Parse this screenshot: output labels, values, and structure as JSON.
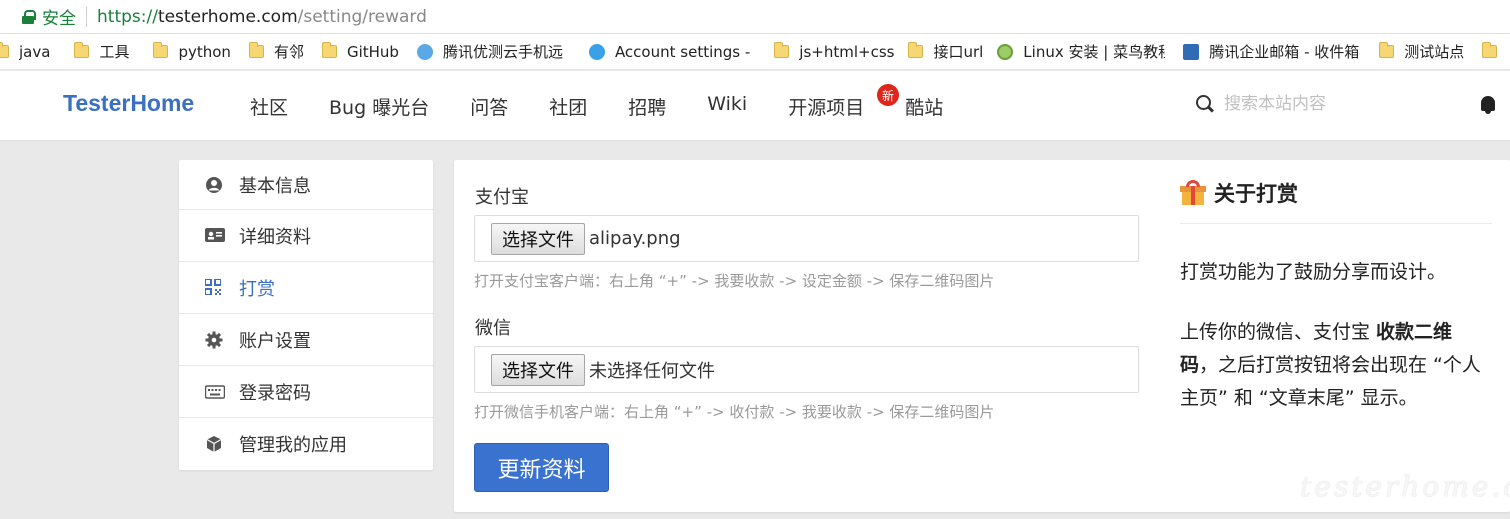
{
  "browser": {
    "secure_label": "安全",
    "url_protocol": "https://",
    "url_host": "testerhome.com",
    "url_path": "/setting/reward"
  },
  "bookmarks": [
    {
      "label": "java",
      "icon": "folder-icon"
    },
    {
      "label": "工具",
      "icon": "folder-icon"
    },
    {
      "label": "python",
      "icon": "folder-icon"
    },
    {
      "label": "有邻",
      "icon": "folder-icon"
    },
    {
      "label": "GitHub",
      "icon": "folder-icon"
    },
    {
      "label": "腾讯优测云手机远程",
      "icon": "cloud-icon"
    },
    {
      "label": "Account settings - ",
      "icon": "account-icon"
    },
    {
      "label": "js+html+css",
      "icon": "folder-icon"
    },
    {
      "label": "接口url",
      "icon": "folder-icon"
    },
    {
      "label": "Linux 安装 | 菜鸟教程",
      "icon": "linux-icon"
    },
    {
      "label": "腾讯企业邮箱 - 收件箱",
      "icon": "mail-icon"
    },
    {
      "label": "测试站点",
      "icon": "folder-icon"
    }
  ],
  "site": {
    "brand": "TesterHome",
    "nav": [
      "社区",
      "Bug 曝光台",
      "问答",
      "社团",
      "招聘",
      "Wiki",
      "开源项目",
      "酷站"
    ],
    "new_badge": "新",
    "search_placeholder": "搜索本站内容"
  },
  "sidemenu": {
    "items": [
      {
        "label": "基本信息",
        "icon": "user-circle-icon",
        "active": false
      },
      {
        "label": "详细资料",
        "icon": "id-card-icon",
        "active": false
      },
      {
        "label": "打赏",
        "icon": "qrcode-icon",
        "active": true
      },
      {
        "label": "账户设置",
        "icon": "gear-icon",
        "active": false
      },
      {
        "label": "登录密码",
        "icon": "keyboard-icon",
        "active": false
      },
      {
        "label": "管理我的应用",
        "icon": "cube-icon",
        "active": false
      }
    ]
  },
  "form": {
    "alipay_label": "支付宝",
    "alipay_button": "选择文件",
    "alipay_file": "alipay.png",
    "alipay_hint": "打开支付宝客户端：右上角 “+” -> 我要收款 -> 设定金额 -> 保存二维码图片",
    "wechat_label": "微信",
    "wechat_button": "选择文件",
    "wechat_file": "未选择任何文件",
    "wechat_hint": "打开微信手机客户端：右上角 “+” -> 收付款 -> 我要收款 -> 保存二维码图片",
    "submit_label": "更新资料"
  },
  "aside": {
    "title": "关于打赏",
    "p1": "打赏功能为了鼓励分享而设计。",
    "p2_before": "上传你的微信、支付宝 ",
    "p2_bold": "收款二维码",
    "p2_after": "，之后打赏按钮将会出现在 “个人主页” 和 “文章末尾” 显示。"
  },
  "watermark": "testerhome.com",
  "colors": {
    "brand": "#3a6fc4",
    "primary_button": "#3a72cf",
    "secure_green": "#188038",
    "badge_red": "#e0261b"
  }
}
